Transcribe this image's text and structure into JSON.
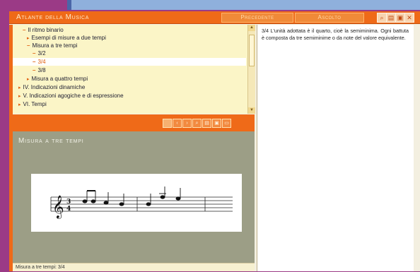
{
  "window": {
    "title": "Atlante della Musica"
  },
  "header": {
    "prev_label": "Precedente",
    "next_label": "Ascolto",
    "icons": [
      "search-icon",
      "print-icon",
      "save-icon",
      "close-icon"
    ]
  },
  "tree": {
    "items": [
      {
        "label": "Il ritmo binario",
        "marker": "dash"
      },
      {
        "label": "Esempi di misure a due tempi",
        "marker": "arrow"
      },
      {
        "label": "Misura a tre tempi",
        "marker": "dash"
      },
      {
        "label": "3/2",
        "marker": "dash"
      },
      {
        "label": "3/4",
        "marker": "dash",
        "selected": true
      },
      {
        "label": "3/8",
        "marker": "dash"
      },
      {
        "label": "Misura a quattro tempi",
        "marker": "arrow"
      },
      {
        "label": "IV. Indicazioni dinamiche",
        "marker": "arrow"
      },
      {
        "label": "V. Indicazioni agogiche e di espressione",
        "marker": "arrow"
      },
      {
        "label": "VI. Tempi",
        "marker": "arrow"
      }
    ]
  },
  "toolbar": {
    "icons": [
      "blank-icon",
      "back-icon",
      "forward-icon",
      "search-icon",
      "print-icon",
      "save-icon",
      "window-icon"
    ]
  },
  "panel": {
    "title": "Misura a tre tempi",
    "score_time_signature": "3/4"
  },
  "statusbar": {
    "text": "Misura a tre tempi: 3/4"
  },
  "description": {
    "text": "3/4 L'unità adottata è il quarto, cioè la semiminima. Ogni battuta è composta da tre semiminime o da note del valore equivalente."
  },
  "colors": {
    "accent": "#ef6a18",
    "frame": "#9b3a86",
    "tree_bg": "#fbf5c7",
    "panel_bg": "#9c9e86"
  }
}
